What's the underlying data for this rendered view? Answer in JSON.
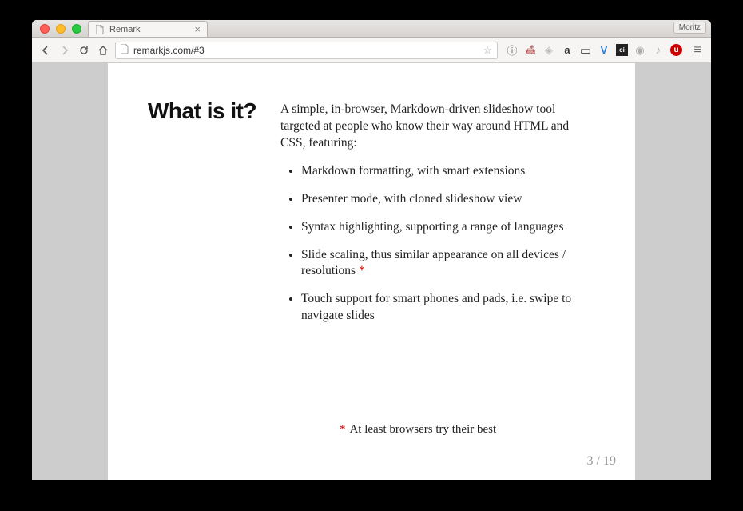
{
  "browser": {
    "tab_title": "Remark",
    "profile_name": "Moritz",
    "url": "remarkjs.com/#3"
  },
  "slide": {
    "heading": "What is it?",
    "intro": "A simple, in-browser, Markdown-driven slideshow tool targeted at people who know their way around HTML and CSS, featuring:",
    "bullets": [
      "Markdown formatting, with smart extensions",
      "Presenter mode, with cloned slideshow view",
      "Syntax highlighting, supporting a range of languages",
      "Slide scaling, thus similar appearance on all devices / resolutions",
      "Touch support for smart phones and pads, i.e. swipe to navigate slides"
    ],
    "bullet_with_star_index": 3,
    "footnote": "At least browsers try their best",
    "page_current": "3",
    "page_total": "19"
  },
  "icons": {
    "info": "ⓘ",
    "couch": "🛋",
    "shield": "◈",
    "amazon": "a",
    "screen": "▭",
    "vue": "V",
    "ci": "ci",
    "camera": "◉",
    "vol": "♪",
    "ublock": "u"
  }
}
